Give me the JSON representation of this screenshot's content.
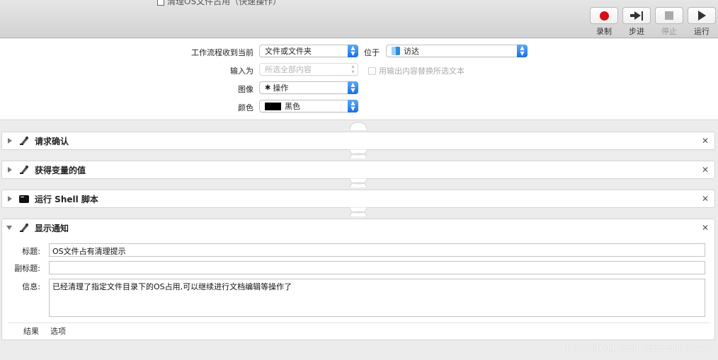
{
  "window": {
    "title": "清理OS文件占用（快速操作）"
  },
  "toolbar": {
    "record_label": "录制",
    "step_label": "步进",
    "stop_label": "停止",
    "run_label": "运行"
  },
  "settings": {
    "workflow_receives_label": "工作流程收到当前",
    "workflow_receives_value": "文件或文件夹",
    "location_label": "位于",
    "location_value": "访达",
    "input_as_label": "输入为",
    "input_as_value": "所选全部内容",
    "replace_checkbox_label": "用输出内容替换所选文本",
    "image_label": "图像",
    "image_value": "操作",
    "color_label": "颜色",
    "color_value": "黑色",
    "color_swatch": "#000000"
  },
  "actions": [
    {
      "title": "请求确认",
      "icon": "automator-robot-icon",
      "expanded": false
    },
    {
      "title": "获得变量的值",
      "icon": "automator-robot-icon",
      "expanded": false
    },
    {
      "title": "运行 Shell 脚本",
      "icon": "terminal-icon",
      "expanded": false
    },
    {
      "title": "显示通知",
      "icon": "automator-robot-icon",
      "expanded": true
    }
  ],
  "notification": {
    "title_label": "标题:",
    "title_value": "OS文件占有清理提示",
    "subtitle_label": "副标题:",
    "subtitle_value": "",
    "message_label": "信息:",
    "message_value": "已经清理了指定文件目录下的OS占用,可以继续进行文档编辑等操作了",
    "results_tab": "结果",
    "options_tab": "选项"
  },
  "watermark": "https://blog.csdn.net/zy987654zy",
  "colors": {
    "record": "#d60f13",
    "popup_accent": "#1b6fe6"
  }
}
